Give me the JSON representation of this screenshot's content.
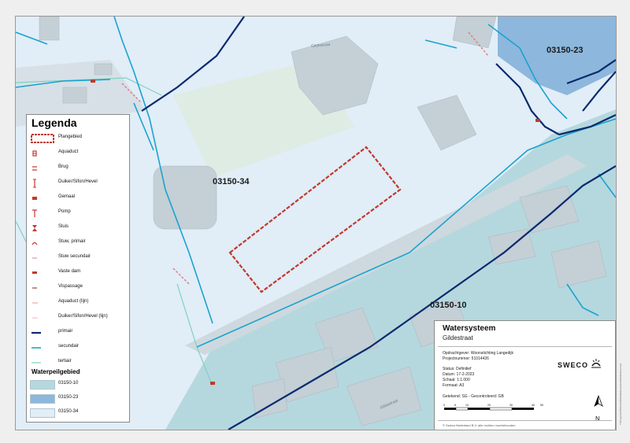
{
  "map": {
    "zones": [
      {
        "id": "03150-34",
        "label": "03150-34"
      },
      {
        "id": "03150-23",
        "label": "03150-23"
      },
      {
        "id": "03150-10",
        "label": "03150-10"
      }
    ],
    "street_labels": [
      "Gildestraat",
      "Gildestraat"
    ],
    "colors": {
      "zone_10": "#b5d8de",
      "zone_23": "#8db7dc",
      "zone_34": "#e1edf7",
      "primair": "#0a2a6e",
      "secundair": "#1aa3cf",
      "tertiair": "#7fd1c2",
      "plangebied": "#c0392b"
    }
  },
  "legend": {
    "title": "Legenda",
    "items": [
      {
        "label": "Plangebied",
        "icon": "plangebied-icon"
      },
      {
        "label": "Aquaduct",
        "icon": "aquaduct-icon"
      },
      {
        "label": "Brug",
        "icon": "brug-icon"
      },
      {
        "label": "Duiker/Sifon/Hevel",
        "icon": "duiker-icon"
      },
      {
        "label": "Gemaal",
        "icon": "gemaal-icon"
      },
      {
        "label": "Pomp",
        "icon": "pomp-icon"
      },
      {
        "label": "Sluis",
        "icon": "sluis-icon"
      },
      {
        "label": "Stuw, primair",
        "icon": "stuw-primair-icon"
      },
      {
        "label": "Stuw secundair",
        "icon": "stuw-secundair-icon"
      },
      {
        "label": "Vaste dam",
        "icon": "vaste-dam-icon"
      },
      {
        "label": "Vispassage",
        "icon": "vispassage-icon"
      },
      {
        "label": "Aquaduct (lijn)",
        "icon": "aquaduct-lijn-icon"
      },
      {
        "label": "Duiker/Sifon/Hevel (lijn)",
        "icon": "duiker-lijn-icon"
      },
      {
        "label": "primair",
        "icon": "primair-line-icon"
      },
      {
        "label": "secundair",
        "icon": "secundair-line-icon"
      },
      {
        "label": "tertiair",
        "icon": "tertiair-line-icon"
      }
    ],
    "peilgebied_title": "Waterpeilgebied",
    "peilgebied": [
      {
        "label": "03150-10",
        "color": "#b5d8de"
      },
      {
        "label": "03150-23",
        "color": "#8db7dc"
      },
      {
        "label": "03150-34",
        "color": "#e1edf7"
      }
    ]
  },
  "titleblock": {
    "title": "Watersysteem",
    "subtitle": "Gildestraat",
    "opdrachtgever": "Opdrachtgever: Woonstichting Langedijk",
    "projectnummer": "Projectnummer: 51014426",
    "status": "Status: Definitief",
    "datum": "Datum: 17-2-2023",
    "schaal": "Schaal: 1:1.000",
    "formaat": "Formaat: A3",
    "getekend": "Getekend: SG - Gecontroleerd: GB",
    "company": "SWECO",
    "north": "N",
    "scale_ticks": [
      "0",
      "5",
      "10",
      "20",
      "30",
      "40",
      "50"
    ],
    "copyright": "© Sweco Nederland B.V. alle rechten voorbehouden"
  },
  "side_text": "Y:\\Projecten\\51014426\\GIS\\Watersysteem\\Gildestraat.mxd"
}
